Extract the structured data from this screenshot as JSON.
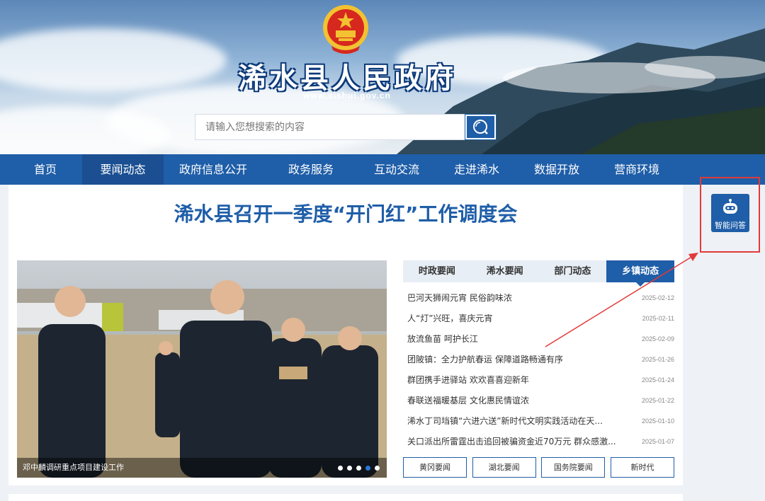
{
  "header": {
    "site_title": "浠水县人民政府",
    "site_url": "www.xishui.gov.cn",
    "search_placeholder": "请输入您想搜索的内容"
  },
  "nav": {
    "items": [
      {
        "label": "首页"
      },
      {
        "label": "要闻动态"
      },
      {
        "label": "政府信息公开"
      },
      {
        "label": "政务服务"
      },
      {
        "label": "互动交流"
      },
      {
        "label": "走进浠水"
      },
      {
        "label": "数据开放"
      },
      {
        "label": "营商环境"
      }
    ],
    "active_index": 1
  },
  "main": {
    "headline": "浠水县召开一季度“开门红”工作调度会",
    "slideshow": {
      "caption": "邓中麟调研重点项目建设工作",
      "slide_count": 5,
      "active_slide": 4
    },
    "news": {
      "tabs": [
        {
          "label": "时政要闻"
        },
        {
          "label": "浠水要闻"
        },
        {
          "label": "部门动态"
        },
        {
          "label": "乡镇动态"
        }
      ],
      "active_tab": 3,
      "items": [
        {
          "title": "巴河天狮闹元宵 民俗韵味浓",
          "date": "2025-02-12"
        },
        {
          "title": "人“灯”兴旺，喜庆元宵",
          "date": "2025-02-11"
        },
        {
          "title": "放流鱼苗 呵护长江",
          "date": "2025-02-09"
        },
        {
          "title": "团陂镇：全力护航春运 保障道路畅通有序",
          "date": "2025-01-26"
        },
        {
          "title": "群团携手进驿站 欢欢喜喜迎新年",
          "date": "2025-01-24"
        },
        {
          "title": "春联送福暖基层 文化惠民情谊浓",
          "date": "2025-01-22"
        },
        {
          "title": "浠水丁司垱镇“六进六送”新时代文明实践活动在天...",
          "date": "2025-01-10"
        },
        {
          "title": "关口派出所雷霆出击追回被骗资金近70万元 群众感激...",
          "date": "2025-01-07"
        }
      ],
      "links": [
        {
          "label": "黄冈要闻"
        },
        {
          "label": "湖北要闻"
        },
        {
          "label": "国务院要闻"
        },
        {
          "label": "新时代"
        }
      ]
    }
  },
  "smart_qa": {
    "label": "智能问答"
  },
  "colors": {
    "primary": "#1f5ea8",
    "nav_active": "#1b4f91",
    "annotation": "#e23a3a"
  }
}
